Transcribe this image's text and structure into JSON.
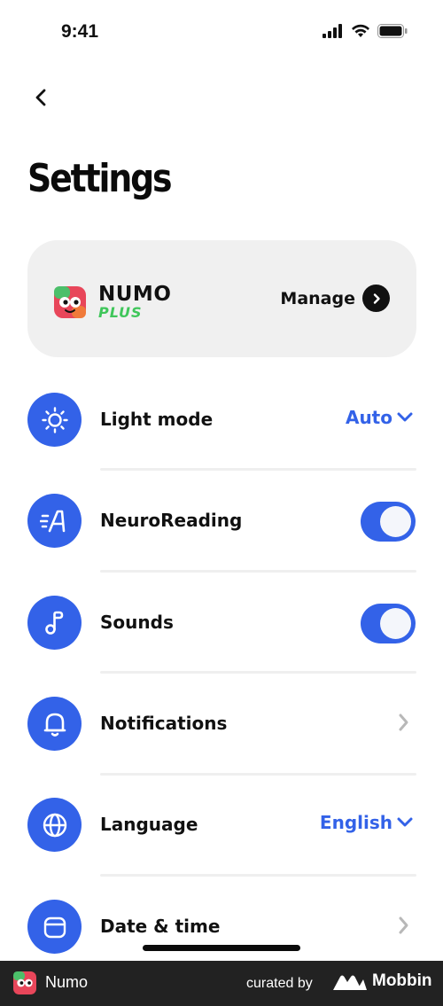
{
  "status_bar": {
    "time": "9:41",
    "icons": [
      "signal-icon",
      "wifi-icon",
      "battery-icon"
    ]
  },
  "header": {
    "back_icon": "chevron-left-icon",
    "title": "Settings"
  },
  "plus_card": {
    "logo_icon": "numo-app-icon",
    "brand_name": "NUMO",
    "brand_tier": "PLUS",
    "manage_label": "Manage",
    "manage_icon": "arrow-right-circle-icon"
  },
  "settings": {
    "items": [
      {
        "label": "Light mode",
        "icon": "sun-icon",
        "control": "dropdown",
        "value": "Auto"
      },
      {
        "label": "NeuroReading",
        "icon": "neuro-reading-icon",
        "control": "toggle",
        "on": true
      },
      {
        "label": "Sounds",
        "icon": "music-note-icon",
        "control": "toggle",
        "on": true
      },
      {
        "label": "Notifications",
        "icon": "bell-icon",
        "control": "chevron"
      },
      {
        "label": "Language",
        "icon": "globe-icon",
        "control": "dropdown",
        "value": "English"
      },
      {
        "label": "Date & time",
        "icon": "calendar-icon",
        "control": "chevron"
      }
    ]
  },
  "colors": {
    "accent": "#3362e8",
    "card_bg": "#f0f0f0",
    "plus_green": "#3fc65a",
    "footer_bg": "#222222"
  },
  "footer": {
    "app_name": "Numo",
    "curated_by": "curated by",
    "brand": "Mobbin"
  }
}
